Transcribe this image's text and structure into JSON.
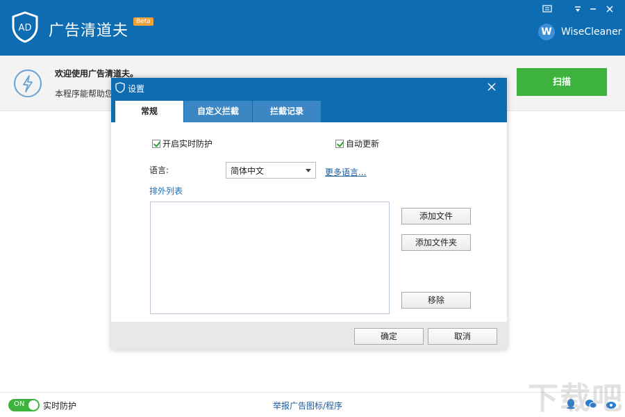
{
  "header": {
    "app_title": "广告清道夫",
    "beta_label": "Beta",
    "logo_text": "AD",
    "brand_initial": "W",
    "brand_name": "WiseCleaner",
    "colors": {
      "primary": "#0e6db2",
      "beta": "#f0a23a"
    }
  },
  "welcome": {
    "title": "欢迎使用广告清道夫。",
    "description": "本程序能帮助您",
    "scan_button": "扫描"
  },
  "dialog": {
    "title": "设置",
    "tabs": [
      {
        "label": "常规",
        "active": true
      },
      {
        "label": "自定义拦截",
        "active": false
      },
      {
        "label": "拦截记录",
        "active": false
      }
    ],
    "realtime_checkbox": {
      "label": "开启实时防护",
      "checked": true
    },
    "autoupdate_checkbox": {
      "label": "自动更新",
      "checked": true
    },
    "language_label": "语言:",
    "language_value": "简体中文",
    "more_languages": "更多语言...",
    "exclusion_label": "排外列表",
    "add_file": "添加文件",
    "add_folder": "添加文件夹",
    "remove": "移除",
    "ok": "确定",
    "cancel": "取消"
  },
  "footer": {
    "toggle_text": "ON",
    "toggle_label": "实时防护",
    "report_link": "举报广告图标/程序"
  },
  "watermark": "下载吧"
}
